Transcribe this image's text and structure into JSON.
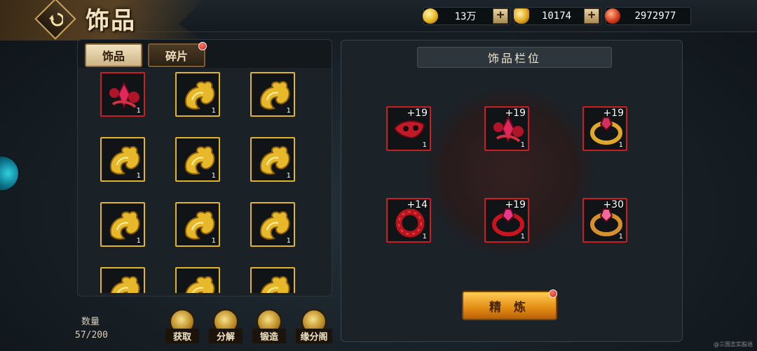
{
  "header": {
    "title": "饰品",
    "back_icon": "back-arrow-icon"
  },
  "currencies": [
    {
      "icon": "gold-coin-icon",
      "value": "13万",
      "has_plus": true
    },
    {
      "icon": "gold-ingot-icon",
      "value": "10174",
      "has_plus": true
    },
    {
      "icon": "red-gem-icon",
      "value": "2972977",
      "has_plus": false
    }
  ],
  "tabs": [
    {
      "label": "饰品",
      "active": true
    },
    {
      "label": "碎片",
      "active": false,
      "has_red_dot": true
    }
  ],
  "inventory": [
    {
      "item": "red-crystal-accessory-icon",
      "count": "1",
      "border": "red"
    },
    {
      "item": "gold-fox-accessory-icon",
      "count": "1",
      "border": "gold"
    },
    {
      "item": "gold-fox-accessory-icon",
      "count": "1",
      "border": "gold"
    },
    {
      "item": "gold-fox-accessory-icon",
      "count": "1",
      "border": "gold"
    },
    {
      "item": "gold-fox-accessory-icon",
      "count": "1",
      "border": "gold"
    },
    {
      "item": "gold-fox-accessory-icon",
      "count": "1",
      "border": "gold"
    },
    {
      "item": "gold-fox-accessory-icon",
      "count": "1",
      "border": "gold"
    },
    {
      "item": "gold-fox-accessory-icon",
      "count": "1",
      "border": "gold"
    },
    {
      "item": "gold-fox-accessory-icon",
      "count": "1",
      "border": "gold"
    },
    {
      "item": "gold-fox-accessory-icon",
      "count": "",
      "border": "gold"
    },
    {
      "item": "gold-fox-accessory-icon",
      "count": "",
      "border": "gold"
    },
    {
      "item": "gold-fox-accessory-icon",
      "count": "",
      "border": "gold"
    }
  ],
  "quantity": {
    "label": "数量",
    "value": "57/200"
  },
  "actions": [
    {
      "label": "获取",
      "icon": "acquire-icon"
    },
    {
      "label": "分解",
      "icon": "decompose-icon"
    },
    {
      "label": "锻造",
      "icon": "forge-hammer-icon"
    },
    {
      "label": "缘分阁",
      "icon": "pavilion-icon"
    }
  ],
  "equipped": {
    "title": "饰品栏位",
    "slots": [
      {
        "item": "red-mask-accessory-icon",
        "level": "+19",
        "count": "1"
      },
      {
        "item": "red-crystal-accessory-icon",
        "level": "+19",
        "count": "1"
      },
      {
        "item": "gold-ring-accessory-icon",
        "level": "+19",
        "count": "1"
      },
      {
        "item": "red-bead-bracelet-icon",
        "level": "+14",
        "count": "1"
      },
      {
        "item": "red-gem-ring-icon",
        "level": "+19",
        "count": "1"
      },
      {
        "item": "gold-ornate-ring-icon",
        "level": "+30",
        "count": "1"
      }
    ],
    "refine_label": "精 炼",
    "refine_red_dot": true
  },
  "watermark": "@三国志实股迷"
}
